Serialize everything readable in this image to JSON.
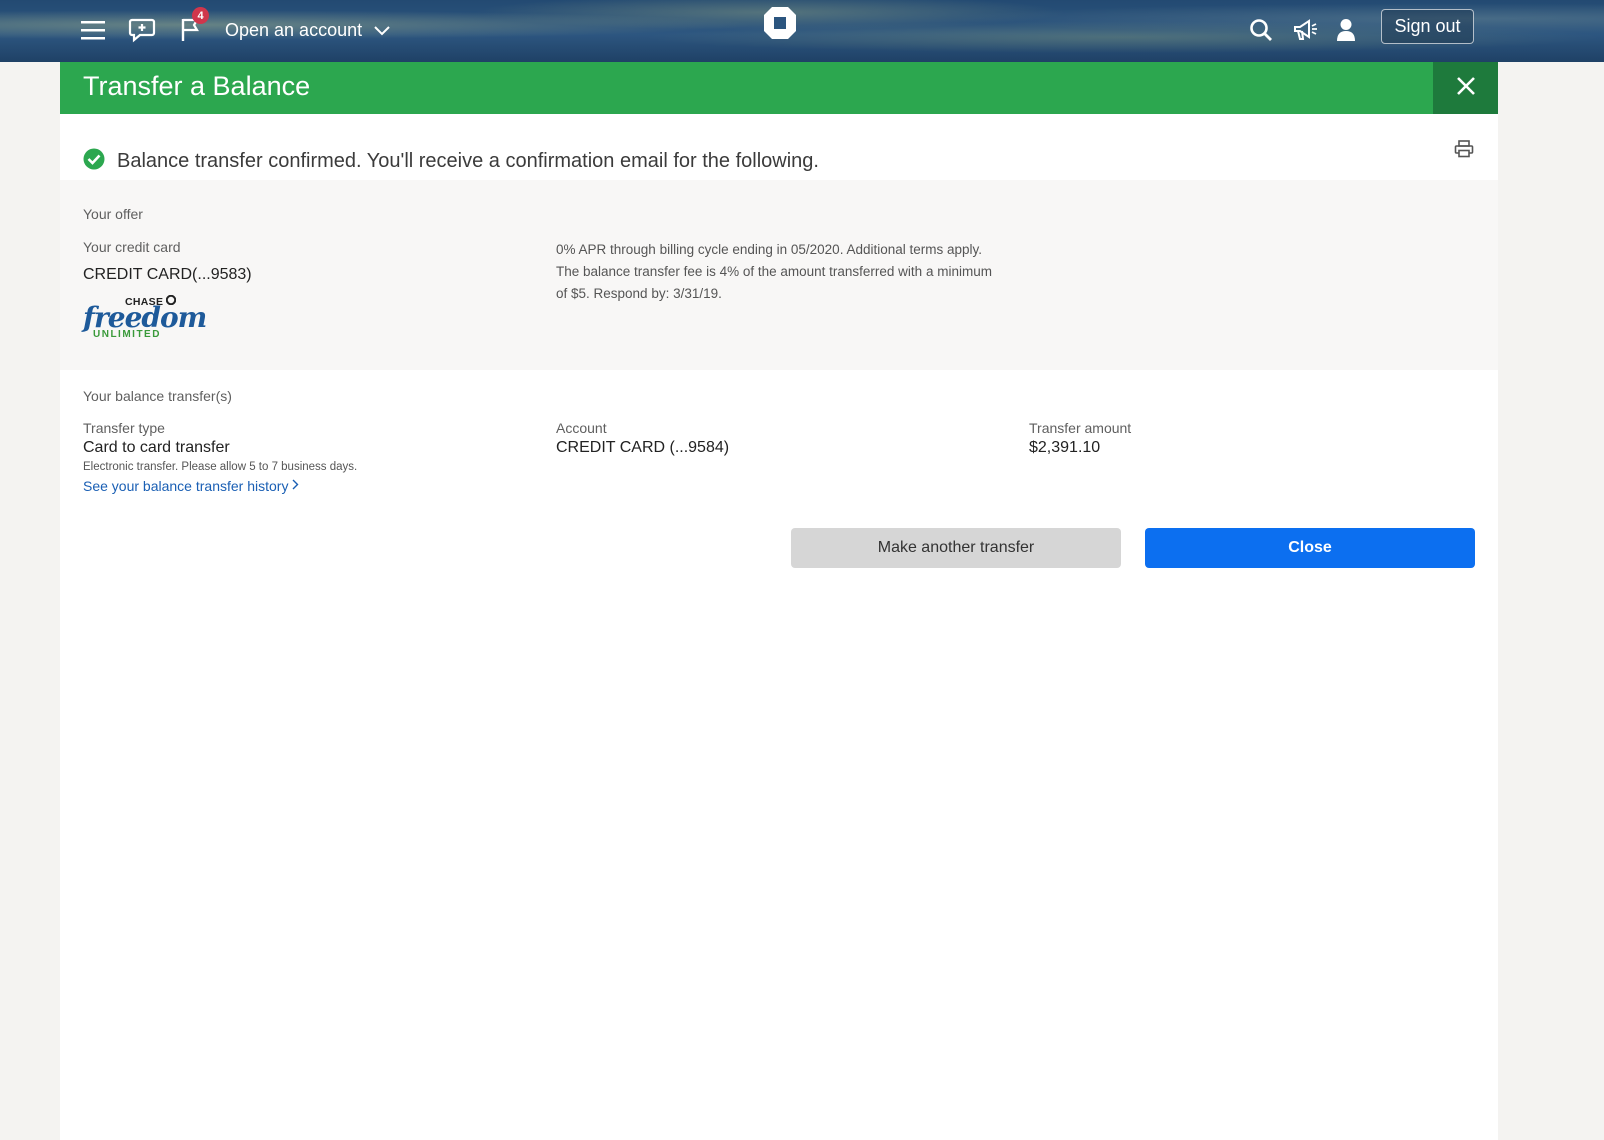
{
  "nav": {
    "open_account_label": "Open an account",
    "notification_count": "4",
    "sign_out_label": "Sign out"
  },
  "panel": {
    "title": "Transfer a Balance",
    "confirmation": "Balance transfer confirmed. You'll receive a confirmation email for the following."
  },
  "offer": {
    "section_label": "Your offer",
    "card_label": "Your credit card",
    "card_value": "CREDIT CARD(...9583)",
    "card_logo": {
      "brand": "CHASE",
      "name": "freedom",
      "sub": "UNLIMITED"
    },
    "terms": "0% APR through billing cycle ending in 05/2020. Additional terms apply. The balance transfer fee is 4% of the amount transferred with a minimum of $5. Respond by: 3/31/19."
  },
  "transfers": {
    "section_label": "Your balance transfer(s)",
    "type_label": "Transfer type",
    "type_value": "Card to card transfer",
    "type_note": "Electronic transfer. Please allow 5 to 7 business days.",
    "history_link": "See your balance transfer history",
    "account_label": "Account",
    "account_value": "CREDIT CARD (...9584)",
    "amount_label": "Transfer amount",
    "amount_value": "$2,391.10"
  },
  "actions": {
    "make_another": "Make another transfer",
    "close": "Close"
  },
  "colors": {
    "header_green": "#2ca74f",
    "header_close_green": "#1e7a3c",
    "primary_blue": "#0c6ff0",
    "secondary_gray": "#d6d6d6",
    "link_blue": "#1a5fb4"
  }
}
